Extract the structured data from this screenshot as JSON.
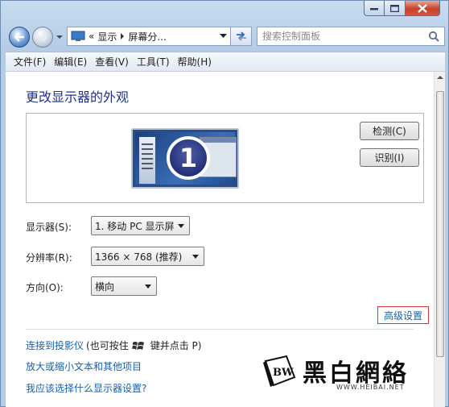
{
  "window": {
    "controls": {
      "minimize": "minimize-icon",
      "maximize": "maximize-icon",
      "close": "close-icon"
    }
  },
  "address": {
    "overflow": "«",
    "crumb1": "显示",
    "crumb2": "屏幕分...",
    "search_placeholder": "搜索控制面板"
  },
  "menu": [
    "文件(F)",
    "编辑(E)",
    "查看(V)",
    "工具(T)",
    "帮助(H)"
  ],
  "page": {
    "title": "更改显示器的外观",
    "monitor_number": "1",
    "detect_button": "检测(C)",
    "identify_button": "识别(I)",
    "display_label": "显示器(S):",
    "display_value": "1. 移动 PC 显示屏",
    "resolution_label": "分辨率(R):",
    "resolution_value": "1366 × 768 (推荐)",
    "orientation_label": "方向(O):",
    "orientation_value": "横向",
    "advanced_link": "高级设置",
    "projector_link": "连接到投影仪",
    "projector_hint_pre": "(也可按住",
    "projector_hint_post": "键并点击 P)",
    "text_size_link": "放大或缩小文本和其他项目",
    "which_settings_link": "我应该选择什么显示器设置?"
  },
  "watermark": {
    "cn": "黑白網絡",
    "en": "WWW.HEIBAI.NET"
  }
}
